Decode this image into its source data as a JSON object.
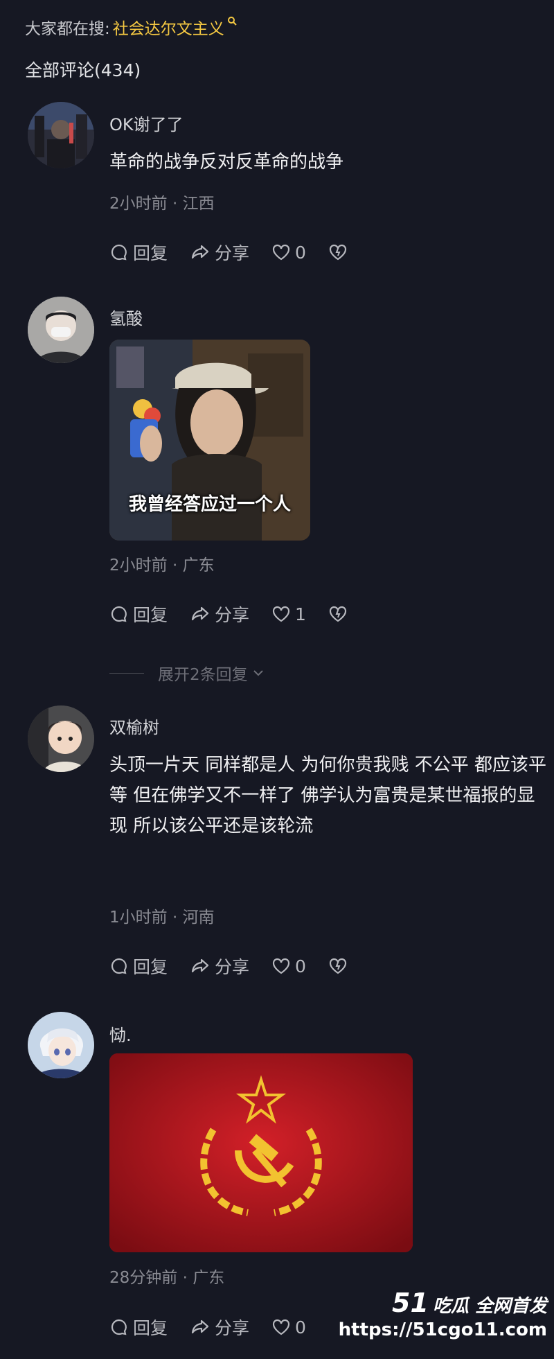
{
  "header": {
    "hot_search_label": "大家都在搜:",
    "hot_search_term": "社会达尔文主义",
    "hot_search_icon": "search-icon",
    "comment_count": "全部评论(434)"
  },
  "comments": [
    {
      "username": "OK谢了了",
      "text": "革命的战争反对反革命的战争",
      "meta": "2小时前 · 江西",
      "reply": "回复",
      "share": "分享",
      "likes": "0"
    },
    {
      "username": "氢酸",
      "sticker_caption": "我曾经答应过一个人",
      "meta": "2小时前 · 广东",
      "reply": "回复",
      "share": "分享",
      "likes": "1",
      "expand_replies": "展开2条回复"
    },
    {
      "username": "双榆树",
      "text": "头顶一片天 同样都是人 为何你贵我贱 不公平 都应该平等 但在佛学又不一样了 佛学认为富贵是某世福报的显现 所以该公平还是该轮流",
      "meta": "1小时前 · 河南",
      "reply": "回复",
      "share": "分享",
      "likes": "0"
    },
    {
      "username": "恸.",
      "meta": "28分钟前 · 广东",
      "reply": "回复",
      "share": "分享",
      "likes": "0"
    }
  ],
  "watermark": {
    "number": "51",
    "brand": "吃瓜 全网首发",
    "url": "https://51cgo11.com"
  },
  "colors": {
    "background": "#161823",
    "accent": "#f4c842",
    "meta_text": "#8a8b93"
  }
}
